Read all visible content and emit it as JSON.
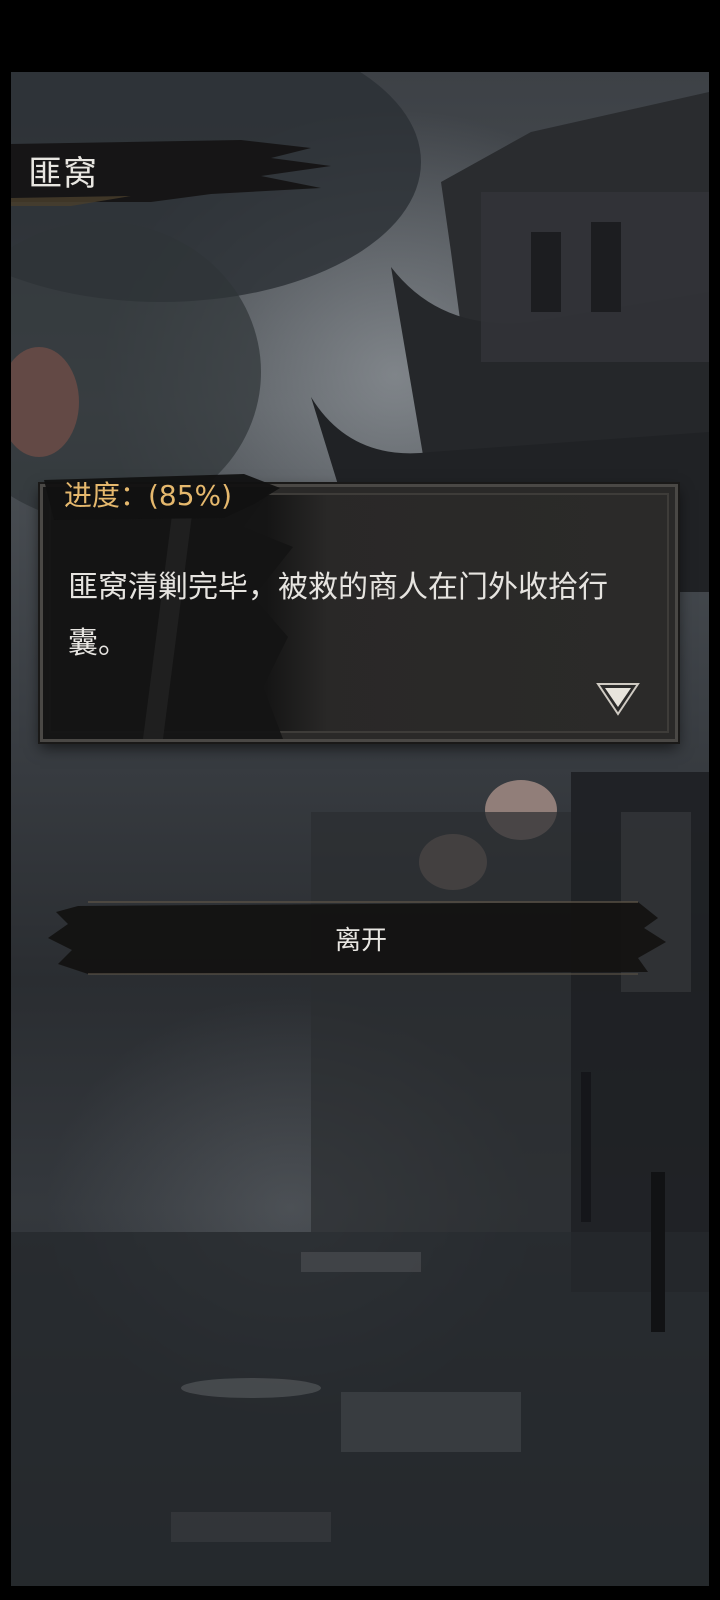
{
  "location": {
    "title": "匪窝"
  },
  "dialog": {
    "progress_label": "进度：(85%)",
    "progress_percent": 85,
    "text": "匪窝清剿完毕，被救的商人在门外收拾行囊。",
    "next_icon": "triangle-down-icon"
  },
  "actions": {
    "leave_label": "离开"
  },
  "colors": {
    "progress_text": "#e5b86d",
    "dialog_bg": "#2a2928",
    "text": "#e6e4e0"
  }
}
